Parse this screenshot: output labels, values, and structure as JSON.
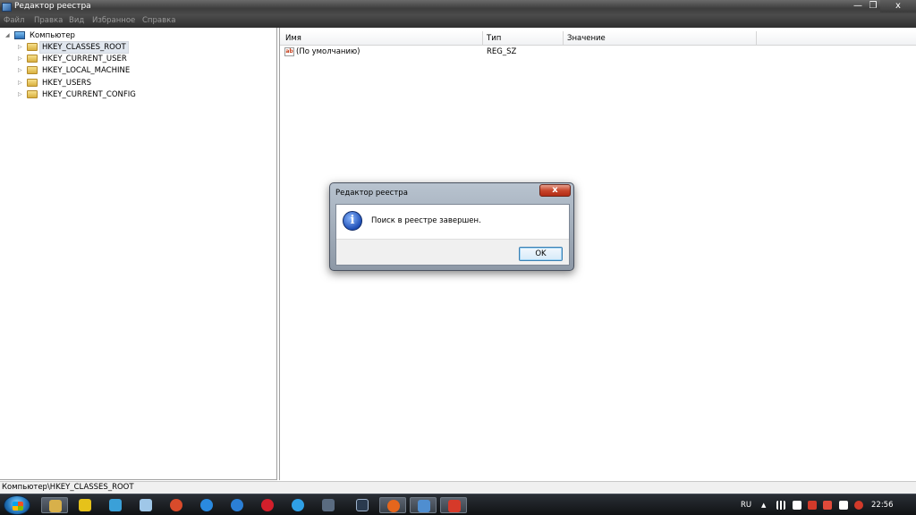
{
  "window": {
    "title": "Редактор реестра",
    "minimize_glyph": "—",
    "maximize_glyph": "❐",
    "close_glyph": "x"
  },
  "menu": [
    "Файл",
    "Правка",
    "Вид",
    "Избранное",
    "Справка"
  ],
  "tree": {
    "root": {
      "label": "Компьютер",
      "icon": "computer-icon",
      "expander": "◢"
    },
    "items": [
      {
        "label": "HKEY_CLASSES_ROOT",
        "selected": true,
        "expander": "▷"
      },
      {
        "label": "HKEY_CURRENT_USER",
        "selected": false,
        "expander": "▷"
      },
      {
        "label": "HKEY_LOCAL_MACHINE",
        "selected": false,
        "expander": "▷"
      },
      {
        "label": "HKEY_USERS",
        "selected": false,
        "expander": "▷"
      },
      {
        "label": "HKEY_CURRENT_CONFIG",
        "selected": false,
        "expander": "▷"
      }
    ]
  },
  "values": {
    "columns": [
      "Имя",
      "Тип",
      "Значение"
    ],
    "rows": [
      {
        "name": "(По умолчанию)",
        "type": "REG_SZ",
        "value": "",
        "icon": "string-value-icon",
        "icon_text": "ab"
      }
    ]
  },
  "statusbar": {
    "path": "Компьютер\\HKEY_CLASSES_ROOT"
  },
  "dialog": {
    "title": "Редактор реестра",
    "message": "Поиск в реестре завершен.",
    "ok_label": "OK",
    "icon": "information-icon",
    "icon_glyph": "i",
    "close_glyph": "x"
  },
  "taskbar": {
    "language": "RU",
    "clock": "22:56",
    "tray_arrow": "▲",
    "apps": [
      {
        "name": "explorer",
        "color": "#d8b04a"
      },
      {
        "name": "outlook",
        "color": "#e6c21a"
      },
      {
        "name": "network",
        "color": "#3aa0d8"
      },
      {
        "name": "notepad",
        "color": "#9fc7e8"
      },
      {
        "name": "tool",
        "color": "#d94b2b"
      },
      {
        "name": "thunderbolt",
        "color": "#2a8ae0"
      },
      {
        "name": "internet-explorer",
        "color": "#2b7fd6"
      },
      {
        "name": "opera",
        "color": "#d21f2b"
      },
      {
        "name": "qip",
        "color": "#2fa0e6"
      },
      {
        "name": "app",
        "color": "#5a6b80"
      },
      {
        "name": "lightroom",
        "color": "#2a3a4e"
      },
      {
        "name": "firefox",
        "color": "#e5661c"
      },
      {
        "name": "regedit",
        "color": "#4f8ed0"
      },
      {
        "name": "presentation",
        "color": "#d63a2a"
      }
    ]
  }
}
